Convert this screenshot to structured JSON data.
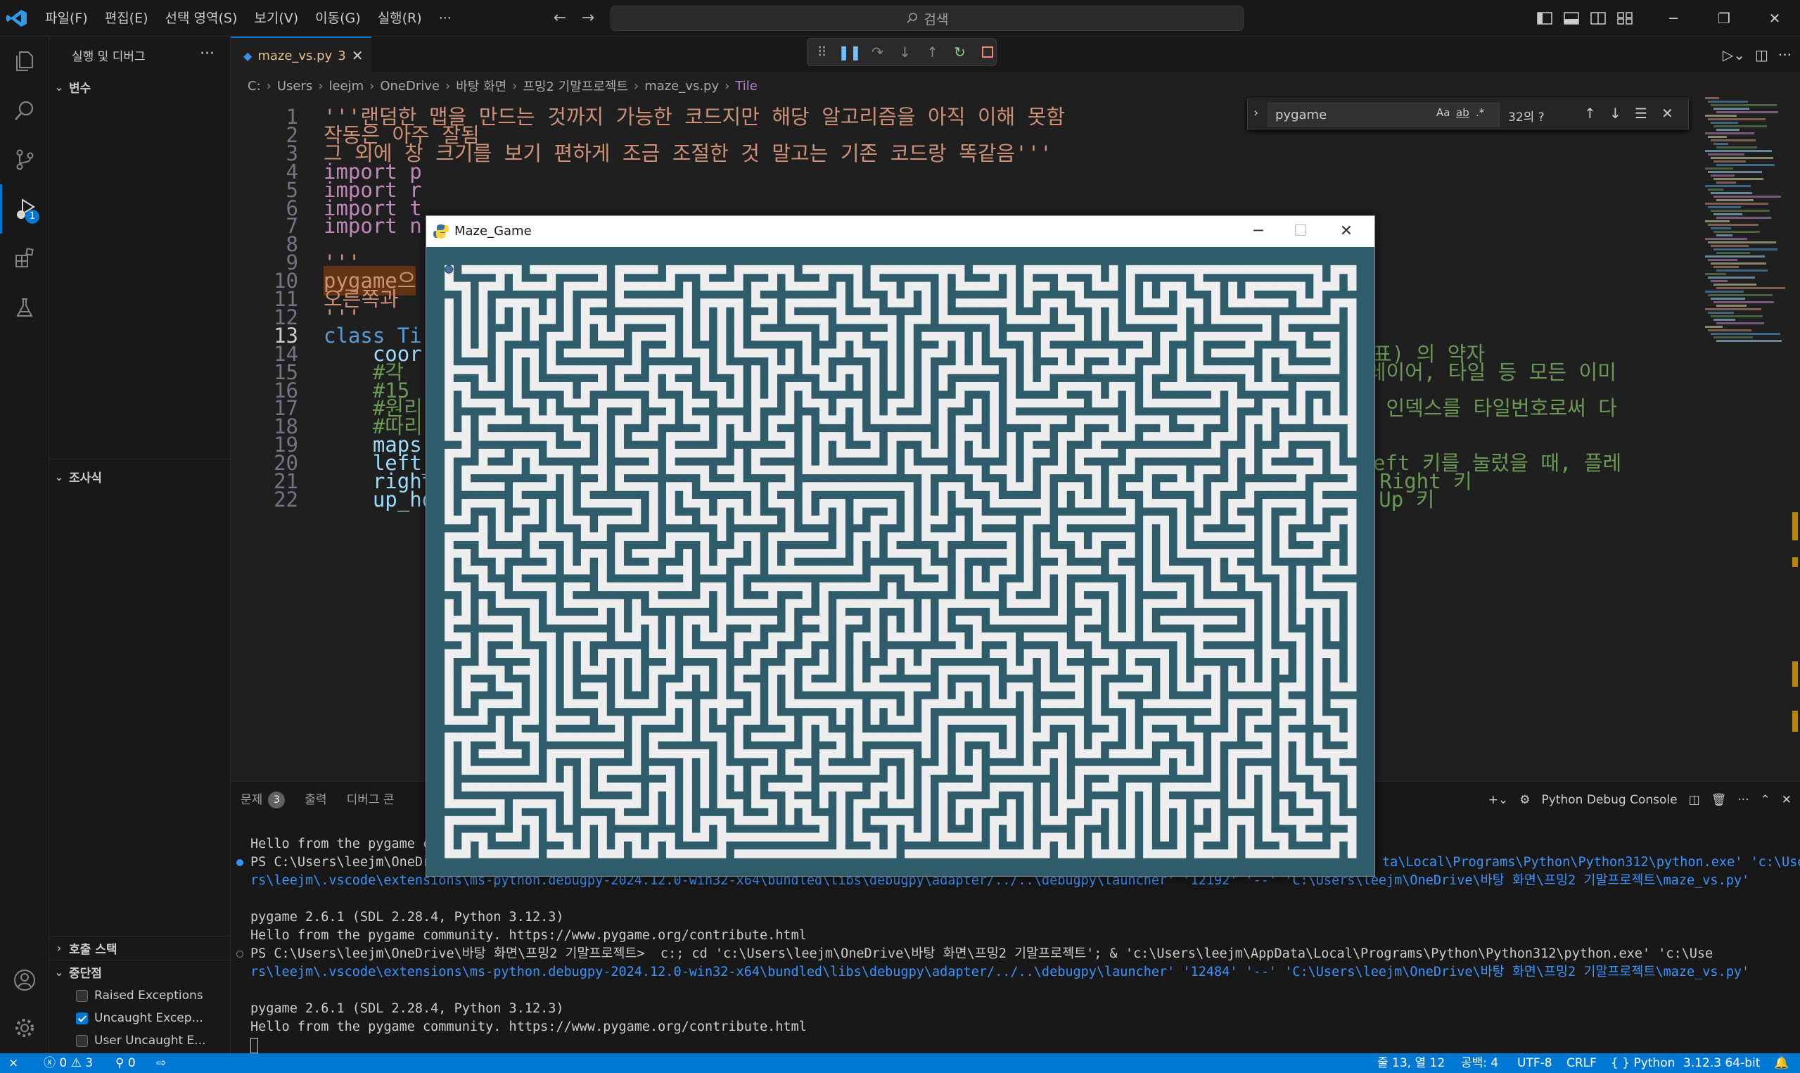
{
  "menu": [
    "파일(F)",
    "편집(E)",
    "선택 영역(S)",
    "보기(V)",
    "이동(G)",
    "실행(R)",
    "···"
  ],
  "search": {
    "placeholder": "검색"
  },
  "sidebar": {
    "title": "실행 및 디버그",
    "variables": "변수",
    "watch": "조사식",
    "call_stack": "호출 스택",
    "breakpoints": "중단점",
    "bp_items": [
      {
        "label": "Raised Exceptions",
        "checked": false
      },
      {
        "label": "Uncaught Excep...",
        "checked": true
      },
      {
        "label": "User Uncaught E...",
        "checked": false
      }
    ]
  },
  "activity_badge": "1",
  "editor": {
    "tab_name": "maze_vs.py",
    "tab_count": "3",
    "breadcrumb": [
      "C:",
      "Users",
      "leejm",
      "OneDrive",
      "바탕 화면",
      "프밍2 기말프로젝트",
      "maze_vs.py",
      "Tile"
    ],
    "find": {
      "query": "pygame",
      "count": "32의 ?",
      "opt_case": "Aa",
      "opt_word": "ab",
      "opt_regex": ".*"
    },
    "lines": [
      {
        "n": "1",
        "t": "'''랜덤한 맵을 만드는 것까지 가능한 코드지만 해당 알고리즘을 아직 이해 못함",
        "c": "str"
      },
      {
        "n": "2",
        "t": "작동은 아주 잘됨",
        "c": "str"
      },
      {
        "n": "3",
        "t": "그 외에 창 크기를 보기 편하게 조금 조절한 것 말고는 기존 코드랑 똑같음'''",
        "c": "str"
      },
      {
        "n": "4",
        "t": "import p",
        "c": "imp"
      },
      {
        "n": "5",
        "t": "import r",
        "c": "imp"
      },
      {
        "n": "6",
        "t": "import t",
        "c": "imp"
      },
      {
        "n": "7",
        "t": "import n",
        "c": "imp"
      },
      {
        "n": "8",
        "t": "",
        "c": "str"
      },
      {
        "n": "9",
        "t": "'''",
        "c": "str"
      },
      {
        "n": "10",
        "t": "pygame으",
        "c": "str"
      },
      {
        "n": "11",
        "t": "오른쪽과",
        "c": "str"
      },
      {
        "n": "12",
        "t": "'''",
        "c": "str"
      },
      {
        "n": "13",
        "t": "class Ti",
        "c": "kw"
      },
      {
        "n": "14",
        "t": "    coor",
        "c": "var"
      },
      {
        "n": "15",
        "t": "    #각 ",
        "c": "cm"
      },
      {
        "n": "16",
        "t": "    #15 ",
        "c": "cm"
      },
      {
        "n": "17",
        "t": "    #원리",
        "c": "cm"
      },
      {
        "n": "18",
        "t": "    #따리",
        "c": "cm"
      },
      {
        "n": "19",
        "t": "    maps",
        "c": "var"
      },
      {
        "n": "20",
        "t": "    left_",
        "c": "var"
      },
      {
        "n": "21",
        "t": "    right",
        "c": "var"
      },
      {
        "n": "22",
        "t": "    up_ho",
        "c": "var"
      }
    ],
    "right_fragments": [
      {
        "line": "14",
        "t": "es(좌표) 의 약자"
      },
      {
        "line": "15",
        "t": "해 플레이어, 타일 등 모든 이미"
      },
      {
        "line": "17",
        "t": "가지는 인덱스를 타일번호로써 다"
      },
      {
        "line": "20",
        "t": "호, Left 키를 눌렀을 때, 플레"
      },
      {
        "line": "21",
        "t": "번호  Right 키"
      },
      {
        "line": "22",
        "t": "     Up 키"
      }
    ]
  },
  "panel": {
    "tabs": [
      "문제",
      "출력",
      "디버그 콘"
    ],
    "problems_count": "3",
    "console_name": "Python Debug Console",
    "terminal": [
      {
        "text": "Hello from the pygame c",
        "dot": ""
      },
      {
        "text": "PS C:\\Users\\leejm\\OneDr",
        "dot": "blue",
        "tail": "ta\\Local\\Programs\\Python\\Python312\\python.exe' 'c:\\Use"
      },
      {
        "text": "rs\\leejm\\.vscode\\extensions\\ms-python.debugpy-2024.12.0-win32-x64\\bundled\\libs\\debugpy\\adapter/../..\\debugpy\\launcher' '12192' '--' 'C:\\Users\\leejm\\OneDrive\\바탕 화면\\프밍2 기말프로젝트\\maze_vs.py'",
        "dot": ""
      },
      {
        "text": "",
        "dot": ""
      },
      {
        "text": "pygame 2.6.1 (SDL 2.28.4, Python 3.12.3)",
        "dot": ""
      },
      {
        "text": "Hello from the pygame community. https://www.pygame.org/contribute.html",
        "dot": ""
      },
      {
        "text": "PS C:\\Users\\leejm\\OneDrive\\바탕 화면\\프밍2 기말프로젝트>  c:; cd 'c:\\Users\\leejm\\OneDrive\\바탕 화면\\프밍2 기말프로젝트'; & 'c:\\Users\\leejm\\AppData\\Local\\Programs\\Python\\Python312\\python.exe' 'c:\\Use",
        "dot": "gray"
      },
      {
        "text": "rs\\leejm\\.vscode\\extensions\\ms-python.debugpy-2024.12.0-win32-x64\\bundled\\libs\\debugpy\\adapter/../..\\debugpy\\launcher' '12484' '--' 'C:\\Users\\leejm\\OneDrive\\바탕 화면\\프밍2 기말프로젝트\\maze_vs.py'",
        "dot": ""
      },
      {
        "text": "",
        "dot": ""
      },
      {
        "text": "pygame 2.6.1 (SDL 2.28.4, Python 3.12.3)",
        "dot": ""
      },
      {
        "text": "Hello from the pygame community. https://www.pygame.org/contribute.html",
        "dot": ""
      }
    ]
  },
  "status": {
    "errors": "0",
    "warnings": "3",
    "ports": "0",
    "position": "줄 13, 열 12",
    "spaces": "공백: 4",
    "encoding": "UTF-8",
    "eol": "CRLF",
    "language": "Python",
    "interpreter": "3.12.3 64-bit"
  },
  "pygame_window": {
    "title": "Maze_Game"
  },
  "colors": {
    "accent": "#0078d4",
    "maze_wall": "#2e5c6b",
    "maze_path": "#eeeeee"
  }
}
